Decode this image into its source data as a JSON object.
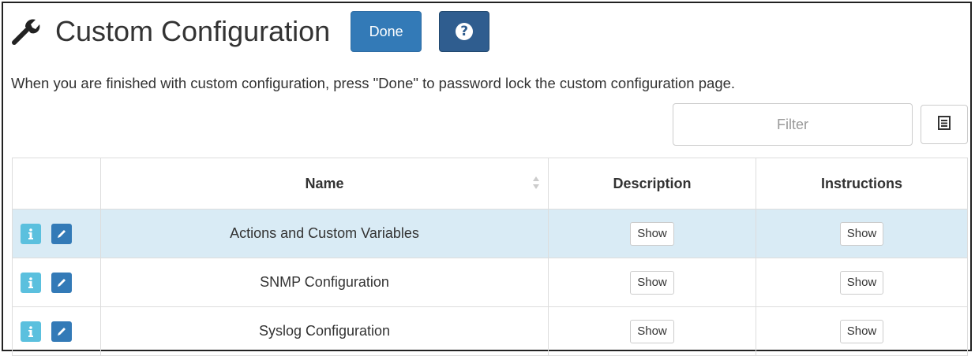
{
  "header": {
    "title": "Custom Configuration",
    "done_label": "Done",
    "help_symbol": "?"
  },
  "instructions": "When you are finished with custom configuration, press \"Done\" to password lock the custom configuration page.",
  "filter": {
    "placeholder": "Filter",
    "value": ""
  },
  "icons": {
    "title": "wrench-icon",
    "help": "question-circle-icon",
    "columns": "list-icon",
    "sort": "sort-icon",
    "info": "info-icon",
    "edit": "pencil-icon"
  },
  "colors": {
    "primary": "#337ab7",
    "help_button": "#2f5d8f",
    "info_button": "#5bc0de",
    "row_highlight": "#d9ebf5"
  },
  "table": {
    "columns": [
      "",
      "Name",
      "Description",
      "Instructions"
    ],
    "rows": [
      {
        "name": "Actions and Custom Variables",
        "description_label": "Show",
        "instructions_label": "Show"
      },
      {
        "name": "SNMP Configuration",
        "description_label": "Show",
        "instructions_label": "Show"
      },
      {
        "name": "Syslog Configuration",
        "description_label": "Show",
        "instructions_label": "Show"
      }
    ]
  }
}
